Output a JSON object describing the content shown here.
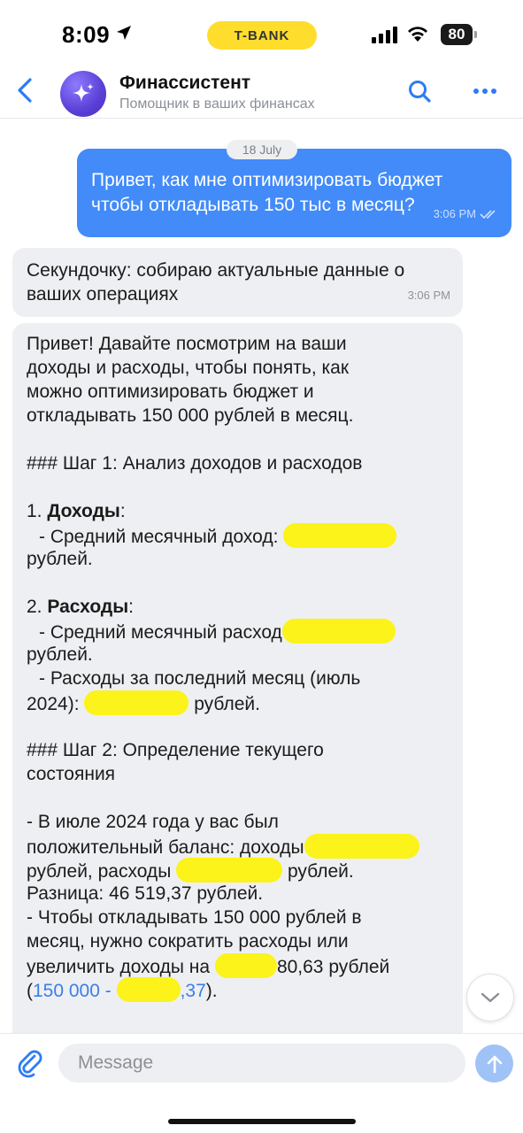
{
  "status_bar": {
    "time": "8:09",
    "carrier_badge": "T-BANK",
    "battery": "80",
    "icons": [
      "location-arrow-icon",
      "signal-icon",
      "wifi-icon",
      "battery-icon"
    ]
  },
  "header": {
    "title": "Финассистент",
    "subtitle": "Помощник в ваших финансах",
    "icons": [
      "back-chevron-icon",
      "sparkle-icon",
      "search-icon",
      "more-dots-icon"
    ]
  },
  "chat": {
    "date_chip": "18 July",
    "outgoing": {
      "lines": [
        "Привет, как мне оптимизировать бюджет",
        "чтобы откладывать 150 тыс в месяц?"
      ],
      "time": "3:06 PM",
      "status_icon": "double-check-icon"
    },
    "incoming_1": {
      "lines": [
        "Секундочку: собираю актуальные данные о",
        "ваших операциях"
      ],
      "time": "3:06 PM"
    },
    "incoming_2": {
      "intro": [
        "Привет! Давайте посмотрим на ваши",
        "доходы и расходы, чтобы понять, как",
        "можно оптимизировать бюджет и",
        "откладывать 150 000 рублей в месяц."
      ],
      "step1_heading": "### Шаг 1: Анализ доходов и расходов",
      "income_num": "1. ",
      "income_label": "Доходы",
      "income_colon": ":",
      "income_avg": "- Средний месячный доход:",
      "rubles_word": "рублей.",
      "expense_num": "2. ",
      "expense_label": "Расходы",
      "expense_colon": ":",
      "expense_avg": "- Средний месячный расход",
      "expense_last_1": "- Расходы за последний месяц (июль",
      "expense_last_2a": "2024):",
      "expense_last_2b": "рублей.",
      "step2_heading_1": "### Шаг 2: Определение текущего",
      "step2_heading_2": "состояния",
      "july_1": "- В июле 2024 года у вас был",
      "july_2": "положительный баланс: доходы",
      "july_3a": "рублей, расходы",
      "july_3b": "рублей.",
      "difference": "Разница: 46 519,37 рублей.",
      "save_1": "- Чтобы откладывать 150 000 рублей в",
      "save_2": "месяц, нужно сократить расходы или",
      "save_3a": "увеличить доходы на",
      "save_3b": "80,63 рублей",
      "calc_open": "(",
      "calc_link_a": "150 000 -",
      "calc_link_b": ",37",
      "calc_close": ")."
    }
  },
  "composer": {
    "placeholder": "Message",
    "icons": [
      "paperclip-icon",
      "send-arrow-icon"
    ]
  },
  "colors": {
    "accent": "#428bf9",
    "incoming_bubble": "#eeeff2",
    "highlight": "#fbf31a",
    "bank_badge": "#ffdd2d",
    "avatar": "#5b3fd6"
  }
}
